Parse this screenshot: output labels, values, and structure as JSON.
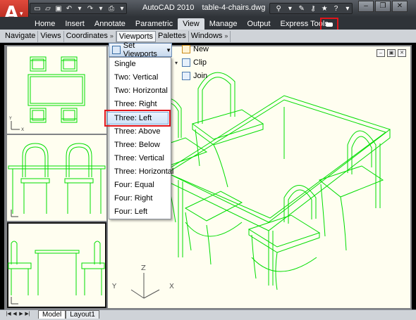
{
  "app": {
    "title": "AutoCAD 2010",
    "filename": "table-4-chairs.dwg"
  },
  "ribbon": {
    "tabs": [
      "Home",
      "Insert",
      "Annotate",
      "Parametric",
      "View",
      "Manage",
      "Output",
      "Express Tools"
    ],
    "active_tab": "View"
  },
  "panels": [
    "Navigate",
    "Views",
    "Coordinates",
    "Viewports",
    "Palettes",
    "Windows"
  ],
  "viewports_menu": {
    "button_label": "Set Viewports",
    "items": [
      "Single",
      "Two:  Vertical",
      "Two:  Horizontal",
      "Three: Right",
      "Three: Left",
      "Three: Above",
      "Three: Below",
      "Three: Vertical",
      "Three: Horizontal",
      "Four:  Equal",
      "Four:  Right",
      "Four:  Left"
    ],
    "highlighted": "Three: Left"
  },
  "viewport_actions": {
    "new_label": "New",
    "clip_label": "Clip",
    "join_label": "Join"
  },
  "axes": {
    "x": "X",
    "y": "Y",
    "z": "Z"
  },
  "layout_tabs": [
    "Model",
    "Layout1"
  ],
  "colors": {
    "drawing_lines": "#00dd00",
    "highlight_box": "#e0141a",
    "viewport_bg": "#fffef0"
  },
  "icons": [
    "application-menu-icon",
    "new-icon",
    "open-icon",
    "save-icon",
    "undo-icon",
    "redo-icon",
    "plot-icon",
    "binoculars-icon",
    "wrench-icon",
    "key-icon",
    "star-icon",
    "help-icon",
    "minimize-icon",
    "restore-icon",
    "close-icon"
  ]
}
